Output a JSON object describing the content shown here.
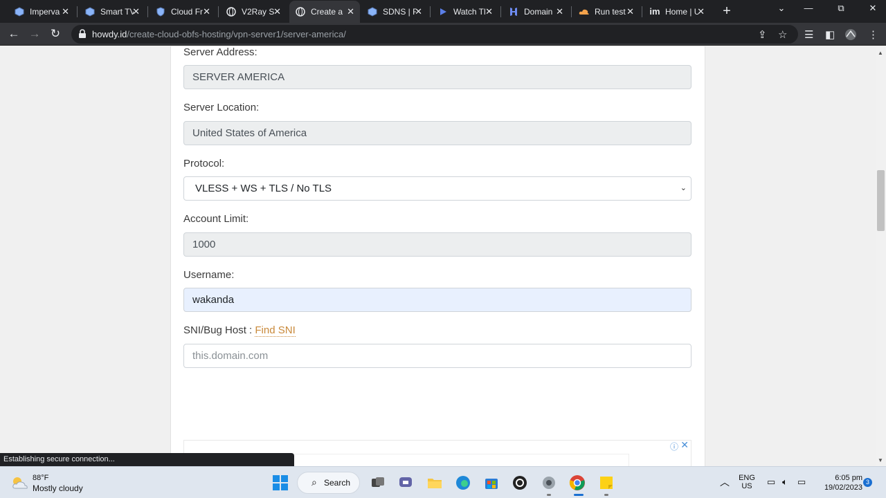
{
  "browser": {
    "tabs": [
      {
        "title": "Imperva",
        "icon": "cube-icon"
      },
      {
        "title": "Smart TV",
        "icon": "cube-icon"
      },
      {
        "title": "Cloud Fr",
        "icon": "shield-icon"
      },
      {
        "title": "V2Ray S",
        "icon": "globe-icon"
      },
      {
        "title": "Create a",
        "icon": "globe-icon",
        "active": true
      },
      {
        "title": "SDNS | F",
        "icon": "cube-icon"
      },
      {
        "title": "Watch Tl",
        "icon": "play-icon"
      },
      {
        "title": "Domain",
        "icon": "h-logo-icon"
      },
      {
        "title": "Run test",
        "icon": "cloud-icon"
      },
      {
        "title": "Home | U",
        "icon": "im-logo-icon"
      }
    ],
    "url_domain": "howdy.id",
    "url_path": "/create-cloud-obfs-hosting/vpn-server1/server-america/"
  },
  "form": {
    "server_address_label": "Server Address:",
    "server_address_value": "SERVER AMERICA",
    "server_location_label": "Server Location:",
    "server_location_value": "United States of America",
    "protocol_label": "Protocol:",
    "protocol_value": "VLESS + WS + TLS / No TLS",
    "account_limit_label": "Account Limit:",
    "account_limit_value": "1000",
    "username_label": "Username:",
    "username_value": "wakanda",
    "sni_label": "SNI/Bug Host :",
    "find_sni_link": "Find SNI",
    "sni_placeholder": "this.domain.com"
  },
  "status_bar": "Establishing secure connection...",
  "taskbar": {
    "weather_temp": "88°F",
    "weather_condition": "Mostly cloudy",
    "search_label": "Search",
    "lang_line1": "ENG",
    "lang_line2": "US",
    "time": "6:05 pm",
    "date": "19/02/2023",
    "notification_count": "3"
  },
  "colors": {
    "tab_strip": "#202124",
    "toolbar": "#35363a",
    "link_accent": "#c9893a",
    "user_field_bg": "#e8f0fe"
  }
}
